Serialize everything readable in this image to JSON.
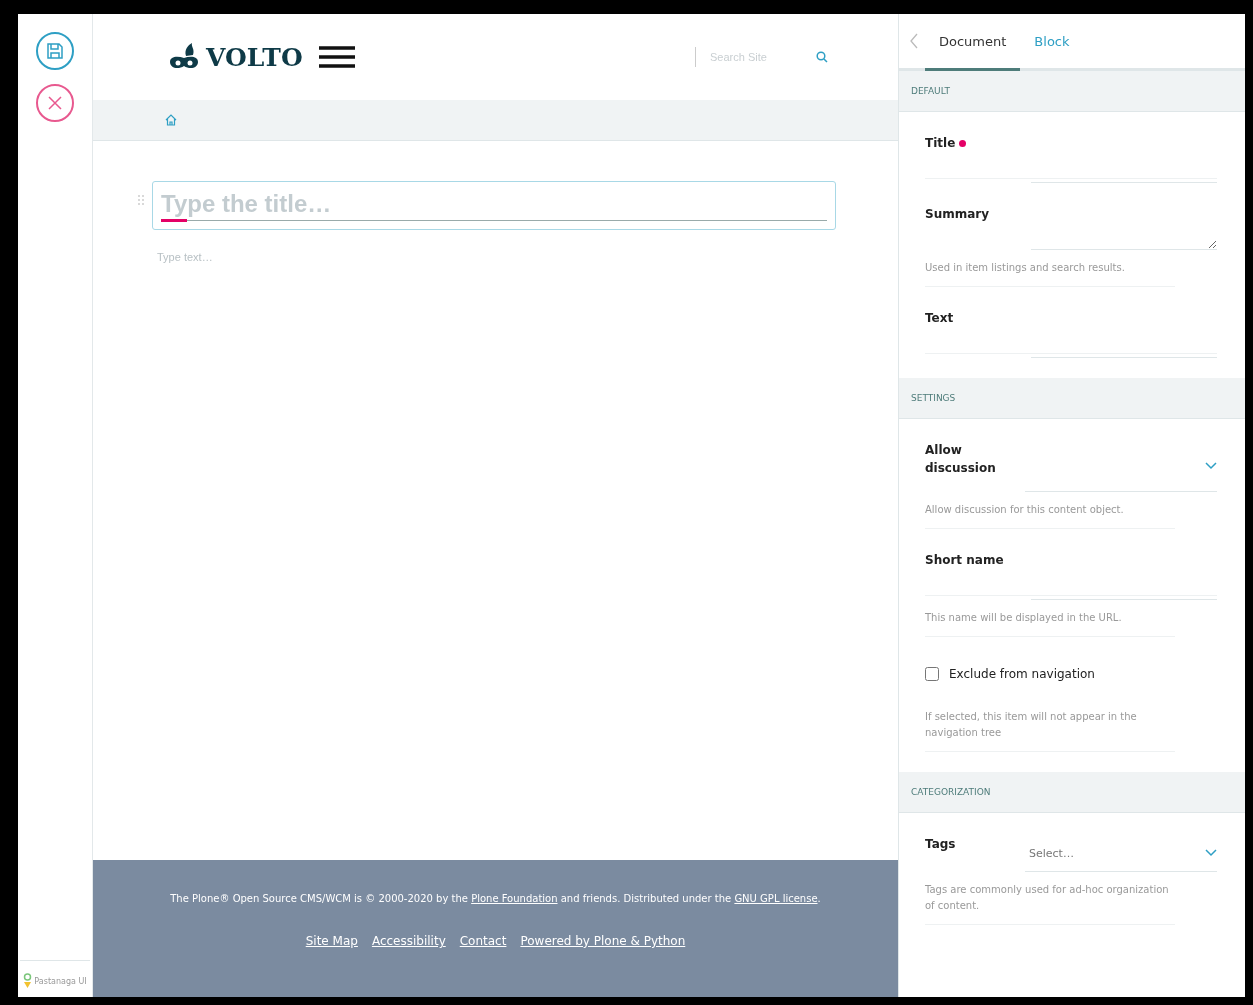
{
  "header": {
    "logo_text": "VOLTO",
    "search_placeholder": "Search Site"
  },
  "editor": {
    "title_placeholder": "Type the title…",
    "text_placeholder": "Type text…"
  },
  "footer": {
    "parts": [
      {
        "kind": "text",
        "text": "The Plone® Open Source CMS/WCM is © 2000-2020 by the "
      },
      {
        "kind": "link",
        "text": "Plone Foundation"
      },
      {
        "kind": "text",
        "text": " and friends. Distributed under the "
      },
      {
        "kind": "link",
        "text": "GNU GPL license"
      },
      {
        "kind": "text",
        "text": "."
      }
    ],
    "links": [
      "Site Map",
      "Accessibility",
      "Contact",
      "Powered by Plone & Python"
    ]
  },
  "toolbar": {
    "brand": "Pastanaga UI"
  },
  "sidebar": {
    "tabs": [
      {
        "label": "Document",
        "selected": true
      },
      {
        "label": "Block",
        "selected": false
      }
    ],
    "sections": [
      {
        "title": "DEFAULT",
        "fields": [
          {
            "kind": "text",
            "label": "Title",
            "required": true
          },
          {
            "kind": "textarea",
            "label": "Summary",
            "help": "Used in item listings and search results."
          },
          {
            "kind": "text",
            "label": "Text"
          }
        ]
      },
      {
        "title": "SETTINGS",
        "fields": [
          {
            "kind": "select",
            "label": "Allow discussion",
            "help": "Allow discussion for this content object."
          },
          {
            "kind": "text",
            "label": "Short name",
            "help": "This name will be displayed in the URL."
          },
          {
            "kind": "checkbox",
            "label": "Exclude from navigation",
            "checked": false,
            "help": "If selected, this item will not appear in the navigation tree"
          }
        ]
      },
      {
        "title": "CATEGORIZATION",
        "fields": [
          {
            "kind": "select",
            "label": "Tags",
            "placeholder": "Select…",
            "help": "Tags are commonly used for ad-hoc organization of content."
          }
        ]
      }
    ]
  }
}
